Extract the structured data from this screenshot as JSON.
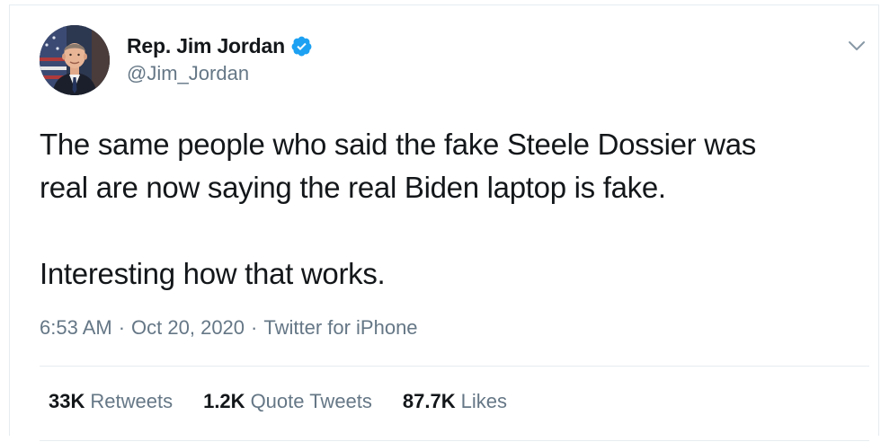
{
  "author": {
    "display_name": "Rep. Jim Jordan",
    "handle": "@Jim_Jordan",
    "verified_icon": "verified-badge-icon",
    "avatar_icon": "profile-avatar"
  },
  "tweet": {
    "paragraph_1_line_1": "The same people who said the fake Steele Dossier was",
    "paragraph_1_line_2": "real are now saying the real Biden laptop is fake.",
    "paragraph_2": "Interesting how that works."
  },
  "meta": {
    "time": "6:53 AM",
    "separator": "·",
    "date": "Oct 20, 2020",
    "source": "Twitter for iPhone"
  },
  "stats": {
    "retweets_count": "33K",
    "retweets_label": "Retweets",
    "quotes_count": "1.2K",
    "quotes_label": "Quote Tweets",
    "likes_count": "87.7K",
    "likes_label": "Likes"
  },
  "colors": {
    "text_primary": "#14171a",
    "text_secondary": "#657786",
    "verified_blue": "#1da1f2",
    "divider": "#e6ecf0"
  }
}
